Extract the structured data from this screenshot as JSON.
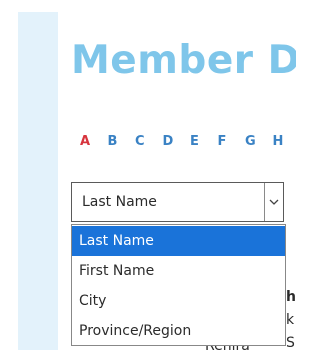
{
  "page": {
    "title": "Member Dir"
  },
  "alphabet": [
    "A",
    "B",
    "C",
    "D",
    "E",
    "F",
    "G",
    "H"
  ],
  "sort_select": {
    "value": "Last Name",
    "options": [
      "Last Name",
      "First Name",
      "City",
      "Province/Region"
    ]
  },
  "background_text": {
    "line1": "h",
    "line2": "k",
    "line3": "S",
    "line4": "Renira"
  },
  "colors": {
    "title": "#7fc6ea",
    "active_letter": "#d7343d",
    "letter": "#3a82c4",
    "selected_option_bg": "#1a73d9",
    "panel_bg": "#e3f2fb"
  },
  "icons": {
    "select_arrow": "chevron-down-icon"
  }
}
